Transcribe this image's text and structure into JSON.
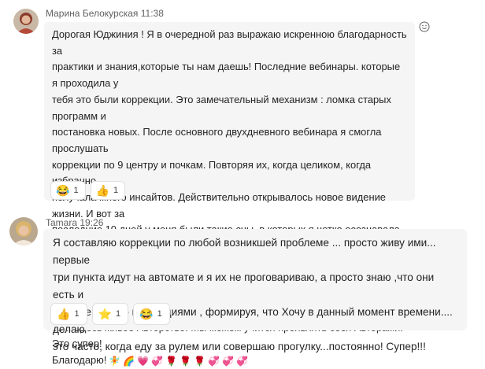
{
  "messages": [
    {
      "author": "Марина Белокурская",
      "time": "11:38",
      "text": "Дорогая Юджиния ! Я в очередной раз выражаю искренною благодарность за\nпрактики и знания,которые ты нам даешь! Последние вебинары. которые я проходила у\nтебя это были коррекции. Это замечательный механизм : ломка старых программ и\nпостановка новых. После основного двухдневного вебинара я смогла прослушать\nкоррекции по 9 центру и почкам. Повторяя их, когда целиком, когда избранно,\nполучала много инсайтов. Действительно открывалось новое видение жизни. И вот за\nпоследние 10 дней у меня были такие сны, в которых я четко осознавала весь спектр\nсобытий, а не одна какая-то сцена. Но самое важное для меня это то,что я находясь во\nсне спонтанно быстро составляла коррекцию события! Это не то как : куда ночь - туда\nсон! Здесь живое Авторство! Мы можем учится проявлять себя Авторами! Это супер!\nБлагодарю!",
      "emojis": [
        "🧚",
        "🌈",
        "💗",
        "💞",
        "🌹",
        "🌹",
        "🌹",
        "💞",
        "💞",
        "💞"
      ],
      "reactions": [
        {
          "icon": "laugh-icon",
          "glyph": "😂",
          "count": "1"
        },
        {
          "icon": "like-icon",
          "glyph": "👍",
          "count": "1"
        }
      ]
    },
    {
      "author": "Tamara",
      "time": "19:26",
      "text": "Я составляю коррекции по любой возникшей  проблеме ... просто живу ими... первые\nтри пункта  идут на автомате и я их не проговариваю, а просто знаю ,что они есть и\nдальше мыслю коррекциями , формируя, что Хочу в данный момент времени.... делаю\nэто часто, когда еду за рулем или совершаю прогулку...постоянно! Супер!!!",
      "reactions": [
        {
          "icon": "like-icon",
          "glyph": "👍",
          "count": "1"
        },
        {
          "icon": "star-icon",
          "glyph": "⭐",
          "count": "1"
        },
        {
          "icon": "laugh-icon",
          "glyph": "😂",
          "count": "1"
        }
      ]
    }
  ],
  "colors": {
    "bubble": "#f5f5f5",
    "meta": "#616161",
    "text": "#242424"
  }
}
